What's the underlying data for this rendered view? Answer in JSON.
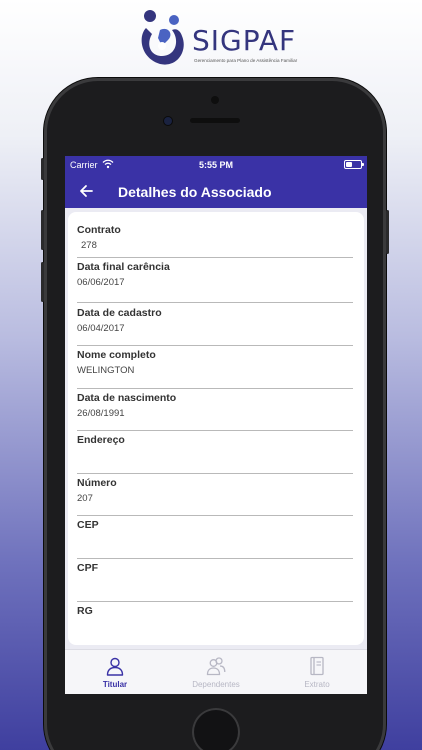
{
  "brand": {
    "name": "SIGPAF",
    "tagline": "Gerenciamento para Plano de Assistência Familiar",
    "color": "#34357e"
  },
  "statusbar": {
    "carrier": "Carrier",
    "time": "5:55 PM"
  },
  "navbar": {
    "title": "Detalhes do Associado",
    "back_icon": "arrow-left-icon",
    "color": "#3a32a6"
  },
  "fields": [
    {
      "label": "Contrato",
      "value": "278"
    },
    {
      "label": "Data final carência",
      "value": "06/06/2017"
    },
    {
      "label": "Data de cadastro",
      "value": "06/04/2017"
    },
    {
      "label": "Nome completo",
      "value": "WELINGTON"
    },
    {
      "label": "Data de nascimento",
      "value": "26/08/1991"
    },
    {
      "label": "Endereço",
      "value": ""
    },
    {
      "label": "Número",
      "value": "207"
    },
    {
      "label": "CEP",
      "value": ""
    },
    {
      "label": "CPF",
      "value": ""
    },
    {
      "label": "RG",
      "value": ""
    }
  ],
  "tabs": [
    {
      "label": "Titular",
      "icon": "person-icon",
      "active": true
    },
    {
      "label": "Dependentes",
      "icon": "people-icon",
      "active": false
    },
    {
      "label": "Extrato",
      "icon": "notebook-icon",
      "active": false
    }
  ]
}
